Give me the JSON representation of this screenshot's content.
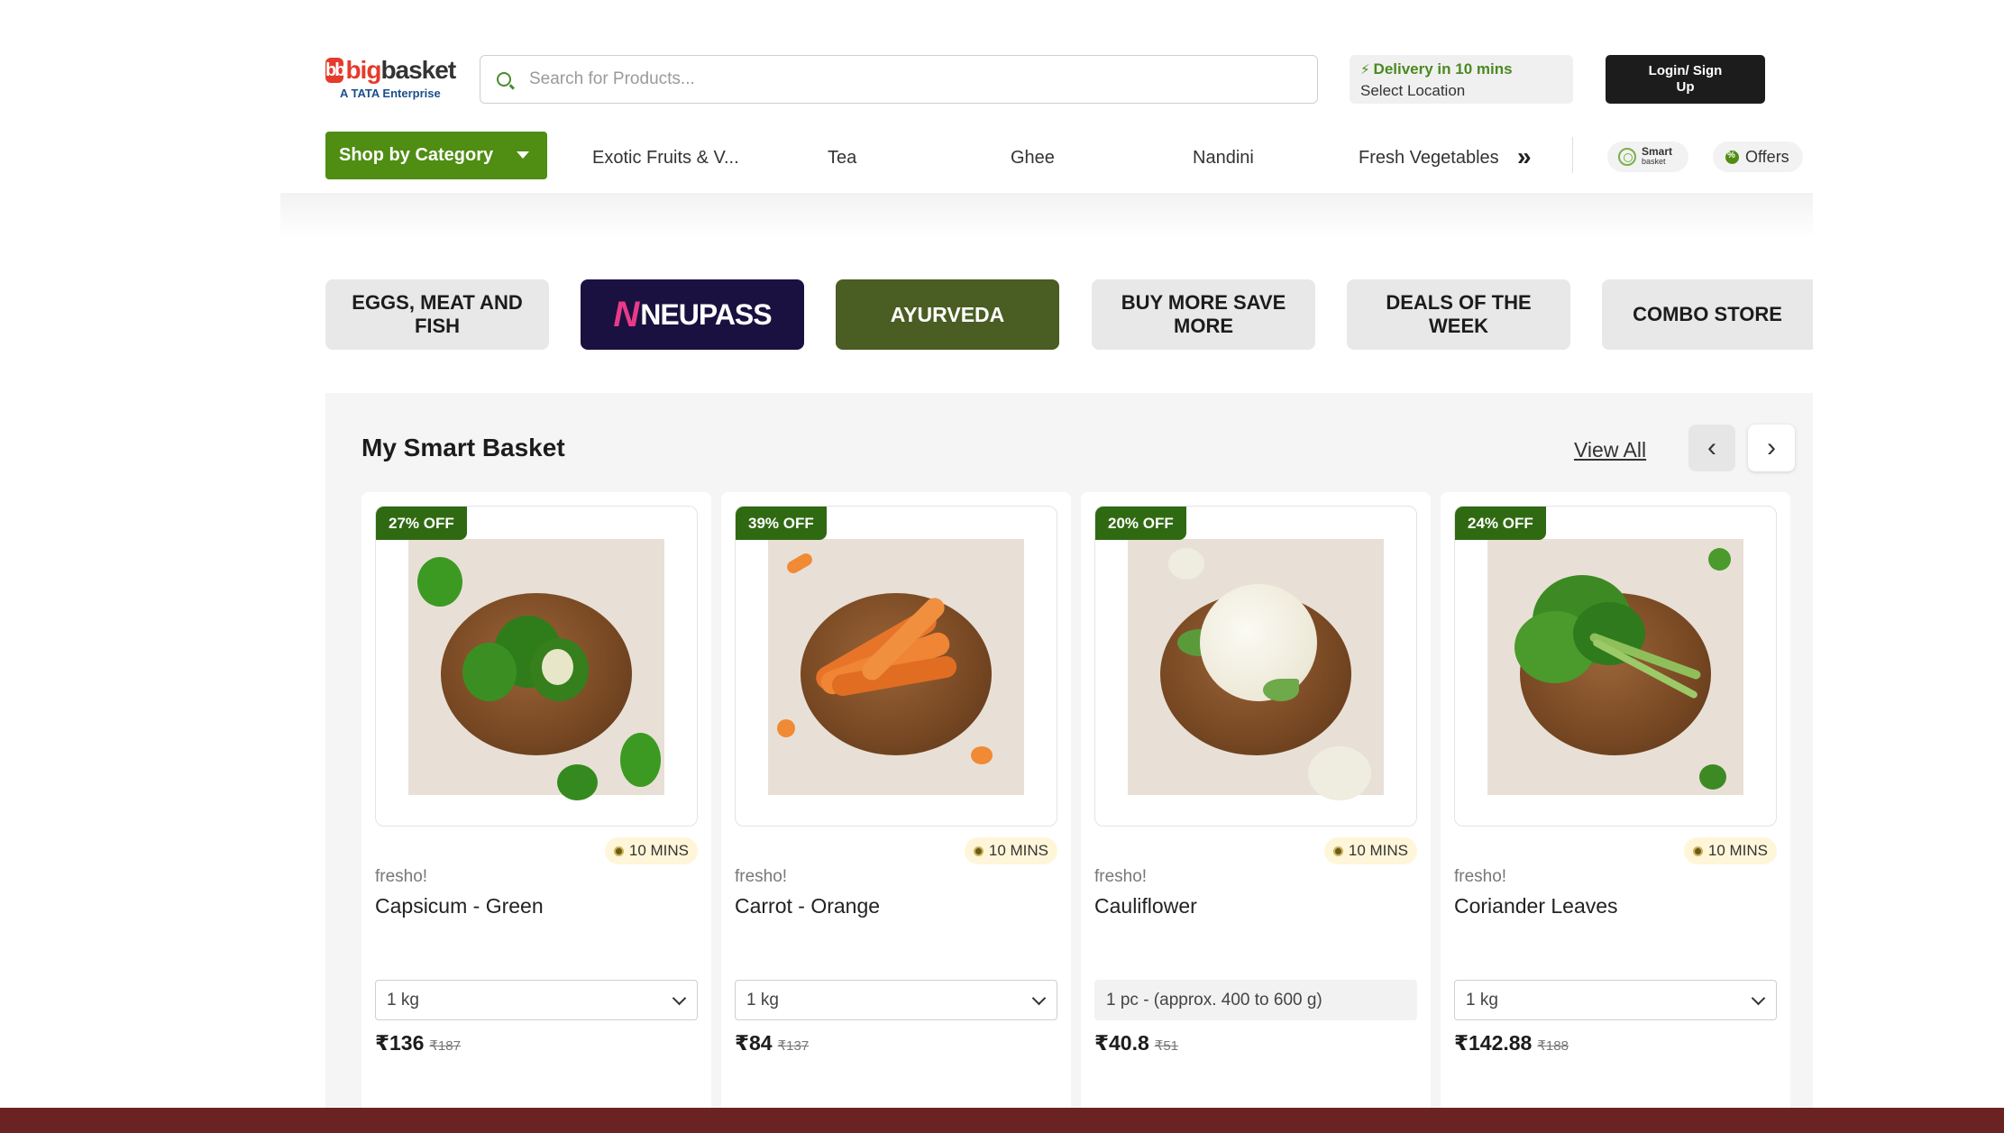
{
  "brand": {
    "logo_mark": "bb",
    "logo_big": "big",
    "logo_basket": "basket",
    "logo_sub": "A TATA Enterprise"
  },
  "search": {
    "placeholder": "Search for Products...",
    "value": ""
  },
  "delivery": {
    "title": "Delivery in 10 mins",
    "location": "Select Location"
  },
  "login": {
    "label": "Login/ Sign Up"
  },
  "nav": {
    "shop_by_category": "Shop by Category",
    "items": [
      "Exotic Fruits & V...",
      "Tea",
      "Ghee",
      "Nandini",
      "Fresh Vegetables"
    ],
    "more": "»",
    "smart_basket_line1": "Smart",
    "smart_basket_line2": "basket",
    "offers": "Offers"
  },
  "tiles": [
    {
      "label": "EGGS, MEAT AND FISH"
    },
    {
      "label": "NEUPASS",
      "mark": "N"
    },
    {
      "label": "AYURVEDA"
    },
    {
      "label": "BUY MORE SAVE MORE"
    },
    {
      "label": "DEALS OF THE WEEK"
    },
    {
      "label": "COMBO STORE"
    }
  ],
  "smart_basket": {
    "title": "My Smart Basket",
    "view_all": "View All",
    "prev": "‹",
    "next": "›",
    "products": [
      {
        "discount": "27% OFF",
        "eta": "10 MINS",
        "brand": "fresho!",
        "name": "Capsicum - Green",
        "qty": "1 kg",
        "price": "₹136",
        "mrp": "₹187"
      },
      {
        "discount": "39% OFF",
        "eta": "10 MINS",
        "brand": "fresho!",
        "name": "Carrot - Orange",
        "qty": "1 kg",
        "price": "₹84",
        "mrp": "₹137"
      },
      {
        "discount": "20% OFF",
        "eta": "10 MINS",
        "brand": "fresho!",
        "name": "Cauliflower",
        "qty": "1 pc - (approx. 400 to 600 g)",
        "price": "₹40.8",
        "mrp": "₹51"
      },
      {
        "discount": "24% OFF",
        "eta": "10 MINS",
        "brand": "fresho!",
        "name": "Coriander Leaves",
        "qty": "1 kg",
        "price": "₹142.88",
        "mrp": "₹188"
      }
    ]
  },
  "colors": {
    "brand_green": "#4f8d13",
    "badge_green": "#2f6a12",
    "login_bg": "#1c1c1c",
    "neupass_bg": "#1a1140",
    "ayurveda_bg": "#4a5d23",
    "footer_bar": "#6b2222"
  }
}
